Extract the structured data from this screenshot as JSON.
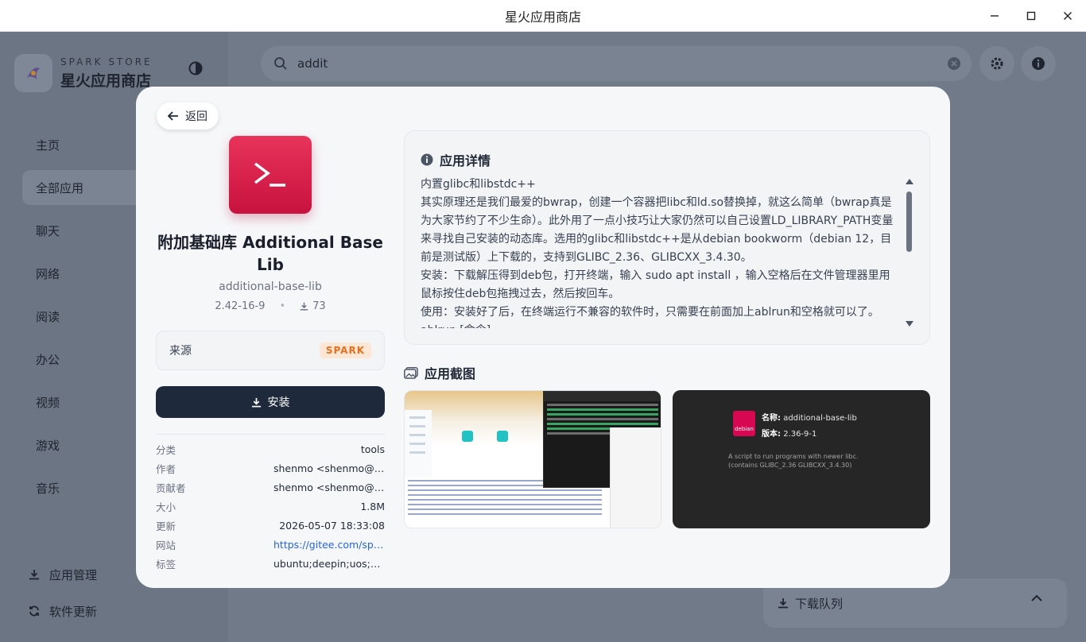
{
  "window": {
    "title": "星火应用商店"
  },
  "sidebar": {
    "brand_sub": "SPARK STORE",
    "brand_name": "星火应用商店",
    "items": [
      {
        "label": "主页"
      },
      {
        "label": "全部应用"
      },
      {
        "label": "聊天"
      },
      {
        "label": "网络"
      },
      {
        "label": "阅读"
      },
      {
        "label": "办公"
      },
      {
        "label": "视频"
      },
      {
        "label": "游戏"
      },
      {
        "label": "音乐"
      }
    ],
    "bottom": [
      {
        "label": "应用管理"
      },
      {
        "label": "软件更新"
      }
    ]
  },
  "search": {
    "value": "addit"
  },
  "queue": {
    "label": "下载队列"
  },
  "detail": {
    "back_label": "返回",
    "title": "附加基础库 Additional Base Lib",
    "package": "additional-base-lib",
    "version": "2.42-16-9",
    "downloads": "73",
    "source_label": "来源",
    "source_badge": "SPARK",
    "install_label": "安装",
    "meta": [
      {
        "key": "分类",
        "value": "tools"
      },
      {
        "key": "作者",
        "value": "shenmo <shenmo@spark-app.store>"
      },
      {
        "key": "贡献者",
        "value": "shenmo <shenmo@spark-app.store>"
      },
      {
        "key": "大小",
        "value": "1.8M"
      },
      {
        "key": "更新",
        "value": "2026-05-07 18:33:08"
      },
      {
        "key": "网站",
        "value": "https://gitee.com/spark-store-project"
      },
      {
        "key": "标签",
        "value": "ubuntu;deepin;uos;debian"
      }
    ],
    "description_title": "应用详情",
    "description": [
      "内置glibc和libstdc++",
      "其实原理还是我们最爱的bwrap，创建一个容器把libc和ld.so替换掉，就这么简单（bwrap真是为大家节约了不少生命）。此外用了一点小技巧让大家仍然可以自己设置LD_LIBRARY_PATH变量来寻找自己安装的动态库。选用的glibc和libstdc++是从debian bookworm（debian 12，目前是测试版）上下载的，支持到GLIBC_2.36、GLIBCXX_3.4.30。",
      "安装：下载解压得到deb包，打开终端，输入 sudo apt install ，输入空格后在文件管理器里用鼠标按住deb包拖拽过去，然后按回车。",
      "使用：安装好了后，在终端运行不兼容的软件时，只需要在前面加上ablrun和空格就可以了。",
      "ablrun [命令]"
    ],
    "screenshots_title": "应用截图",
    "shot2": {
      "name_label": "名称:",
      "name_value": "additional-base-lib",
      "version_label": "版本:",
      "version_value": "2.36-9-1",
      "desc": "A script to run programs with newer libc. (contains GLIBC_2.36 GLIBCXX_3.4.30)",
      "icon_text": "debian"
    }
  }
}
